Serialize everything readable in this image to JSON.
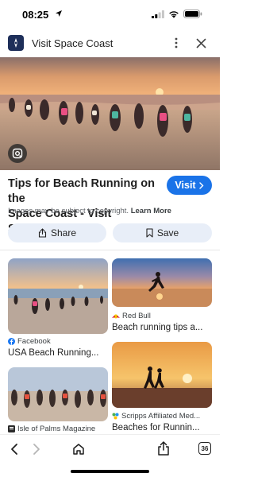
{
  "status_bar": {
    "time": "08:25"
  },
  "header": {
    "site_title": "Visit Space Coast"
  },
  "result": {
    "title_line1": "Tips for Beach Running on the",
    "title_line2": "Space Coast - Visit Space...",
    "visit_label": "Visit",
    "copyright_text": "Images may be subject to copyright.",
    "learn_more_label": "Learn More"
  },
  "actions": {
    "share_label": "Share",
    "save_label": "Save"
  },
  "related": [
    {
      "source": "Facebook",
      "title": "USA Beach Running...",
      "source_icon": "facebook-icon"
    },
    {
      "source": "Red Bull",
      "title": "Beach running tips a...",
      "source_icon": "red-bull-icon"
    },
    {
      "source": "Isle of Palms Magazine",
      "title": "",
      "source_icon": "magazine-icon"
    },
    {
      "source": "Scripps Affiliated Med...",
      "title": "Beaches for Runnin...",
      "source_icon": "scripps-icon"
    }
  ],
  "bottom_bar": {
    "tab_count": "36"
  },
  "colors": {
    "accent": "#1a73e8",
    "chip_bg": "#e8eef8",
    "facebook": "#1877f2"
  }
}
